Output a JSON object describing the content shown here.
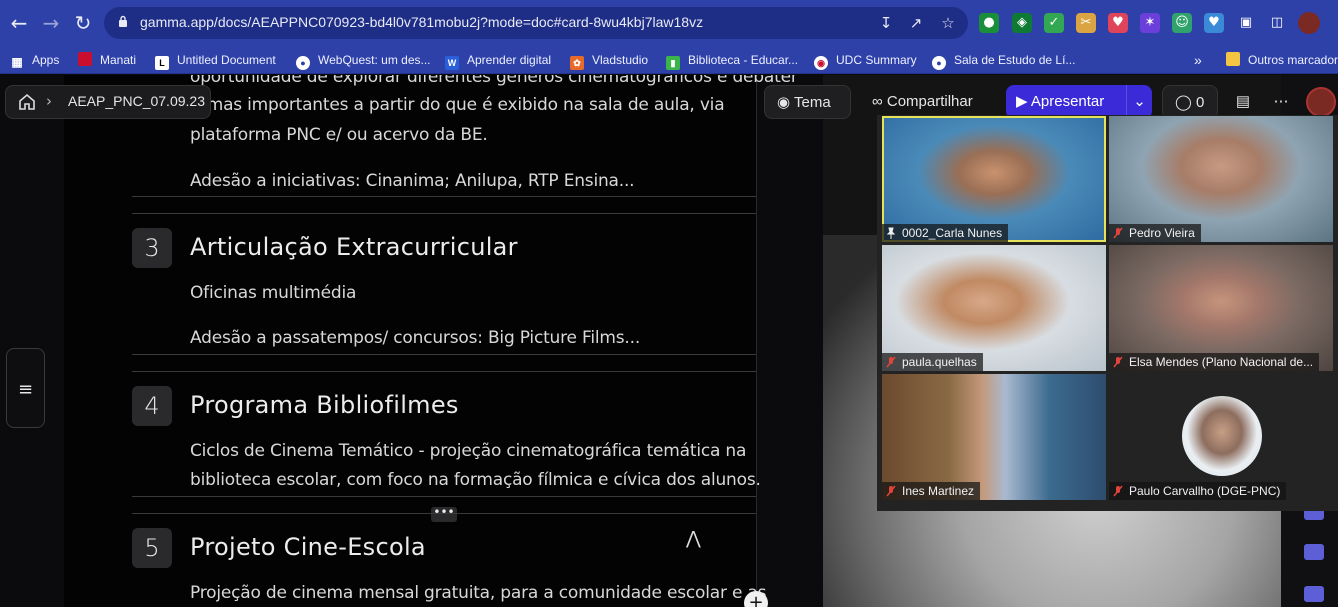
{
  "browser": {
    "url": "gamma.app/docs/AEAPPNC070923-bd4l0v781mobu2j?mode=doc#card-8wu4kbj7law18vz",
    "bookmarks": [
      {
        "label": "Apps"
      },
      {
        "label": "Manati"
      },
      {
        "label": "Untitled Document"
      },
      {
        "label": "WebQuest: um des..."
      },
      {
        "label": "Aprender digital"
      },
      {
        "label": "Vladstudio"
      },
      {
        "label": "Biblioteca - Educar..."
      },
      {
        "label": "UDC Summary"
      },
      {
        "label": "Sala de Estudo de Lí..."
      },
      {
        "label": "»"
      },
      {
        "label": "Outros marcadores"
      }
    ]
  },
  "app": {
    "breadcrumb": "AEAP_PNC_07.09.23",
    "toolbar": {
      "theme": "Tema",
      "share": "Compartilhar",
      "present": "Apresentar",
      "comments_count": "0"
    },
    "dots_label": "•••"
  },
  "doc": {
    "top_lines": [
      "oportunidade de explorar diferentes géneros cinematográficos e debater",
      "temas importantes a partir do que é exibido na sala de aula, via",
      "plataforma PNC e/ ou acervo da BE.",
      "Adesão a iniciativas: Cinanima; Anilupa, RTP Ensina..."
    ],
    "cards": [
      {
        "number": "3",
        "title": "Articulação Extracurricular",
        "lines": [
          "Oficinas multimédia",
          "Adesão a passatempos/ concursos: Big Picture Films..."
        ]
      },
      {
        "number": "4",
        "title": "Programa Bibliofilmes",
        "lines": [
          "Ciclos de Cinema Temático - projeção cinematográfica temática na",
          "biblioteca escolar,  com foco na formação fílmica e cívica dos alunos."
        ]
      },
      {
        "number": "5",
        "title": "Projeto Cine-Escola",
        "lines": [
          "Projeção de cinema mensal gratuita, para a comunidade escolar e as"
        ]
      }
    ]
  },
  "meeting": {
    "participants": [
      {
        "name": "0002_Carla Nunes",
        "active": true
      },
      {
        "name": "Pedro Vieira"
      },
      {
        "name": "paula.quelhas"
      },
      {
        "name": "Elsa Mendes (Plano Nacional de..."
      },
      {
        "name": "Ines Martinez"
      },
      {
        "name": "Paulo Carvallho (DGE-PNC)"
      }
    ]
  },
  "colors": {
    "browser_bar": "#2e41a8",
    "present_button": "#3a2ad8",
    "active_speaker": "#e6e25a",
    "muted_mic": "#e0443a"
  }
}
